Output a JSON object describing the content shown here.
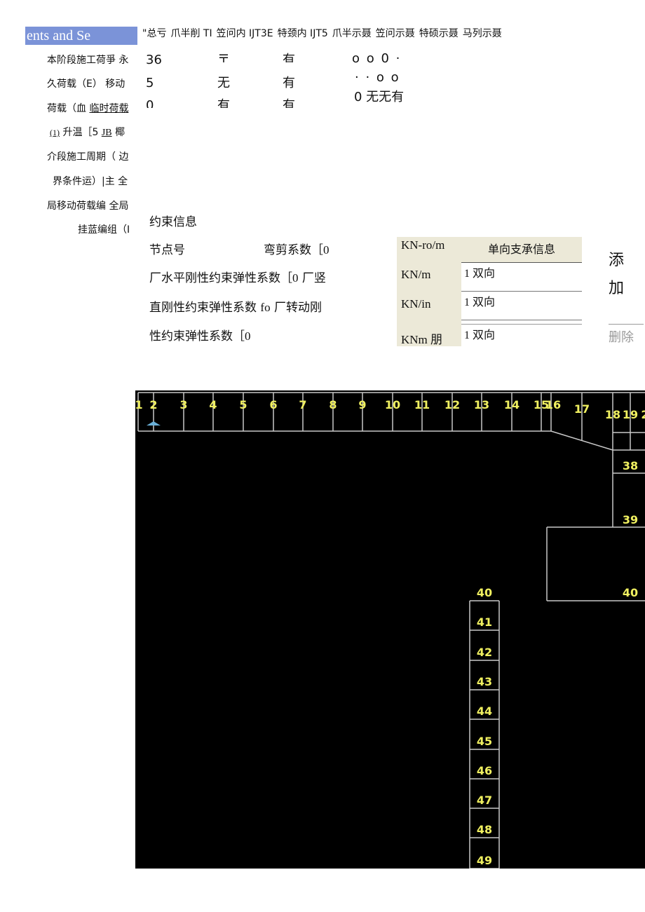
{
  "tabs": {
    "selected": "ents and Se",
    "items": [
      "\"总亏",
      "爪半削 TI",
      "笠问内 IJT3E",
      "特颈内 IJT5",
      "爪半示聂",
      "笠问示聂",
      "特硕示聂",
      "马列示聂"
    ]
  },
  "sidebar": {
    "lines": [
      "本阶段施工荷爭 永",
      "久荷载（E） 移动",
      "荷载（血",
      "临时荷载",
      "(1)",
      "升温［5",
      "JB",
      "椰",
      "介段施工周期（ 边",
      "界条件运）|主 全",
      "局移动荷载编 全局",
      "挂蓝编组（I"
    ]
  },
  "grid_fragment": {
    "col1": [
      "36",
      "5",
      "0"
    ],
    "col2": [
      "〒",
      "无",
      "有"
    ],
    "col3": [
      "有",
      "有",
      "有"
    ],
    "col4_row1": "o o 0 ·",
    "col4_row2": "· · o o",
    "col4_row3": "0 无无有"
  },
  "constraint": {
    "title": "约束信息",
    "node_label": "节点号",
    "bend_shear_label": "弯剪系数［",
    "bend_shear_value": "0",
    "line1": "厂水平刚性约束弹性系数［",
    "line1_value": "0",
    "line1_tail": "厂竖",
    "line2": "直刚性约束弹性系数",
    "line2_value": "fo",
    "line2_tail": "厂转动刚",
    "line3": "性约束弹性系数［",
    "line3_value": "0",
    "units": [
      "KN-ro/m",
      "KN/m",
      "KN/in",
      "KNm 朋"
    ]
  },
  "support_table": {
    "header": "单向支承信息",
    "rows": [
      {
        "num": "1",
        "dir": "双向"
      },
      {
        "num": "1",
        "dir": "双向"
      },
      {
        "num": "1",
        "dir": "双向"
      }
    ]
  },
  "buttons": {
    "add": "添加",
    "delete": "删除"
  },
  "canvas": {
    "top_nodes": [
      "1",
      "2",
      "3",
      "4",
      "5",
      "6",
      "7",
      "8",
      "9",
      "10",
      "11",
      "12",
      "13",
      "14",
      "15",
      "16",
      "17",
      "18",
      "19",
      "2"
    ],
    "right_nodes": [
      "38",
      "39",
      "40"
    ],
    "column_nodes": [
      "40",
      "41",
      "42",
      "43",
      "44",
      "45",
      "46",
      "47",
      "48",
      "49"
    ],
    "line_color": "#c8c8c8",
    "label_color": "#f0f060"
  }
}
